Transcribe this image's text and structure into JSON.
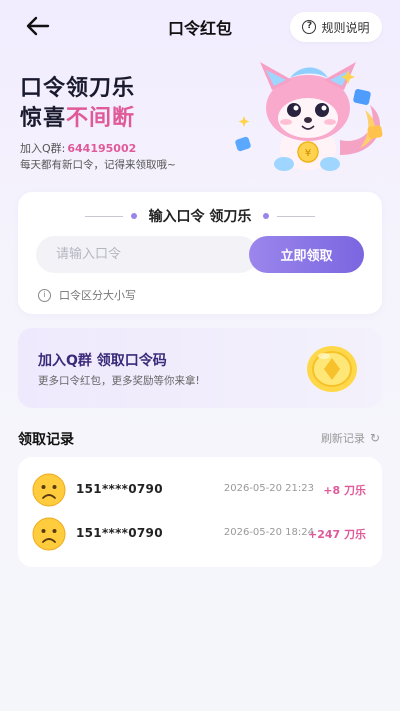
{
  "header": {
    "title": "口令红包",
    "back_icon": "arrow-left-icon",
    "rules_label": "规则说明",
    "rules_icon": "question-circle-icon"
  },
  "hero": {
    "line1": "口令领刀乐",
    "line2_prefix": "惊喜",
    "line2_accent": "不间断",
    "qq_label": "加入Q群:",
    "qq_number": "644195002",
    "subtitle": "每天都有新口令，记得来领取哦~",
    "accent_color": "#e05a9a"
  },
  "redeem": {
    "heading": "输入口令 领刀乐",
    "input_placeholder": "请输入口令",
    "input_value": "",
    "submit_label": "立即领取",
    "note": "口令区分大小写",
    "note_icon": "info-icon"
  },
  "join": {
    "title": "加入Q群 领取口令码",
    "subtitle": "更多口令红包，更多奖励等你来拿!",
    "coin_icon": "gold-coin-icon"
  },
  "records": {
    "title": "领取记录",
    "refresh_label": "刷新记录",
    "refresh_icon": "refresh-icon",
    "items": [
      {
        "user": "151****0790",
        "time": "2026-05-20 21:23",
        "amount": "+8 刀乐",
        "avatar": "sad-face-icon"
      },
      {
        "user": "151****0790",
        "time": "2026-05-20 18:24",
        "amount": "+247 刀乐",
        "avatar": "sad-face-icon"
      }
    ]
  },
  "colors": {
    "primary_purple": "#8b76e6",
    "amount_pink": "#e05a9a"
  }
}
